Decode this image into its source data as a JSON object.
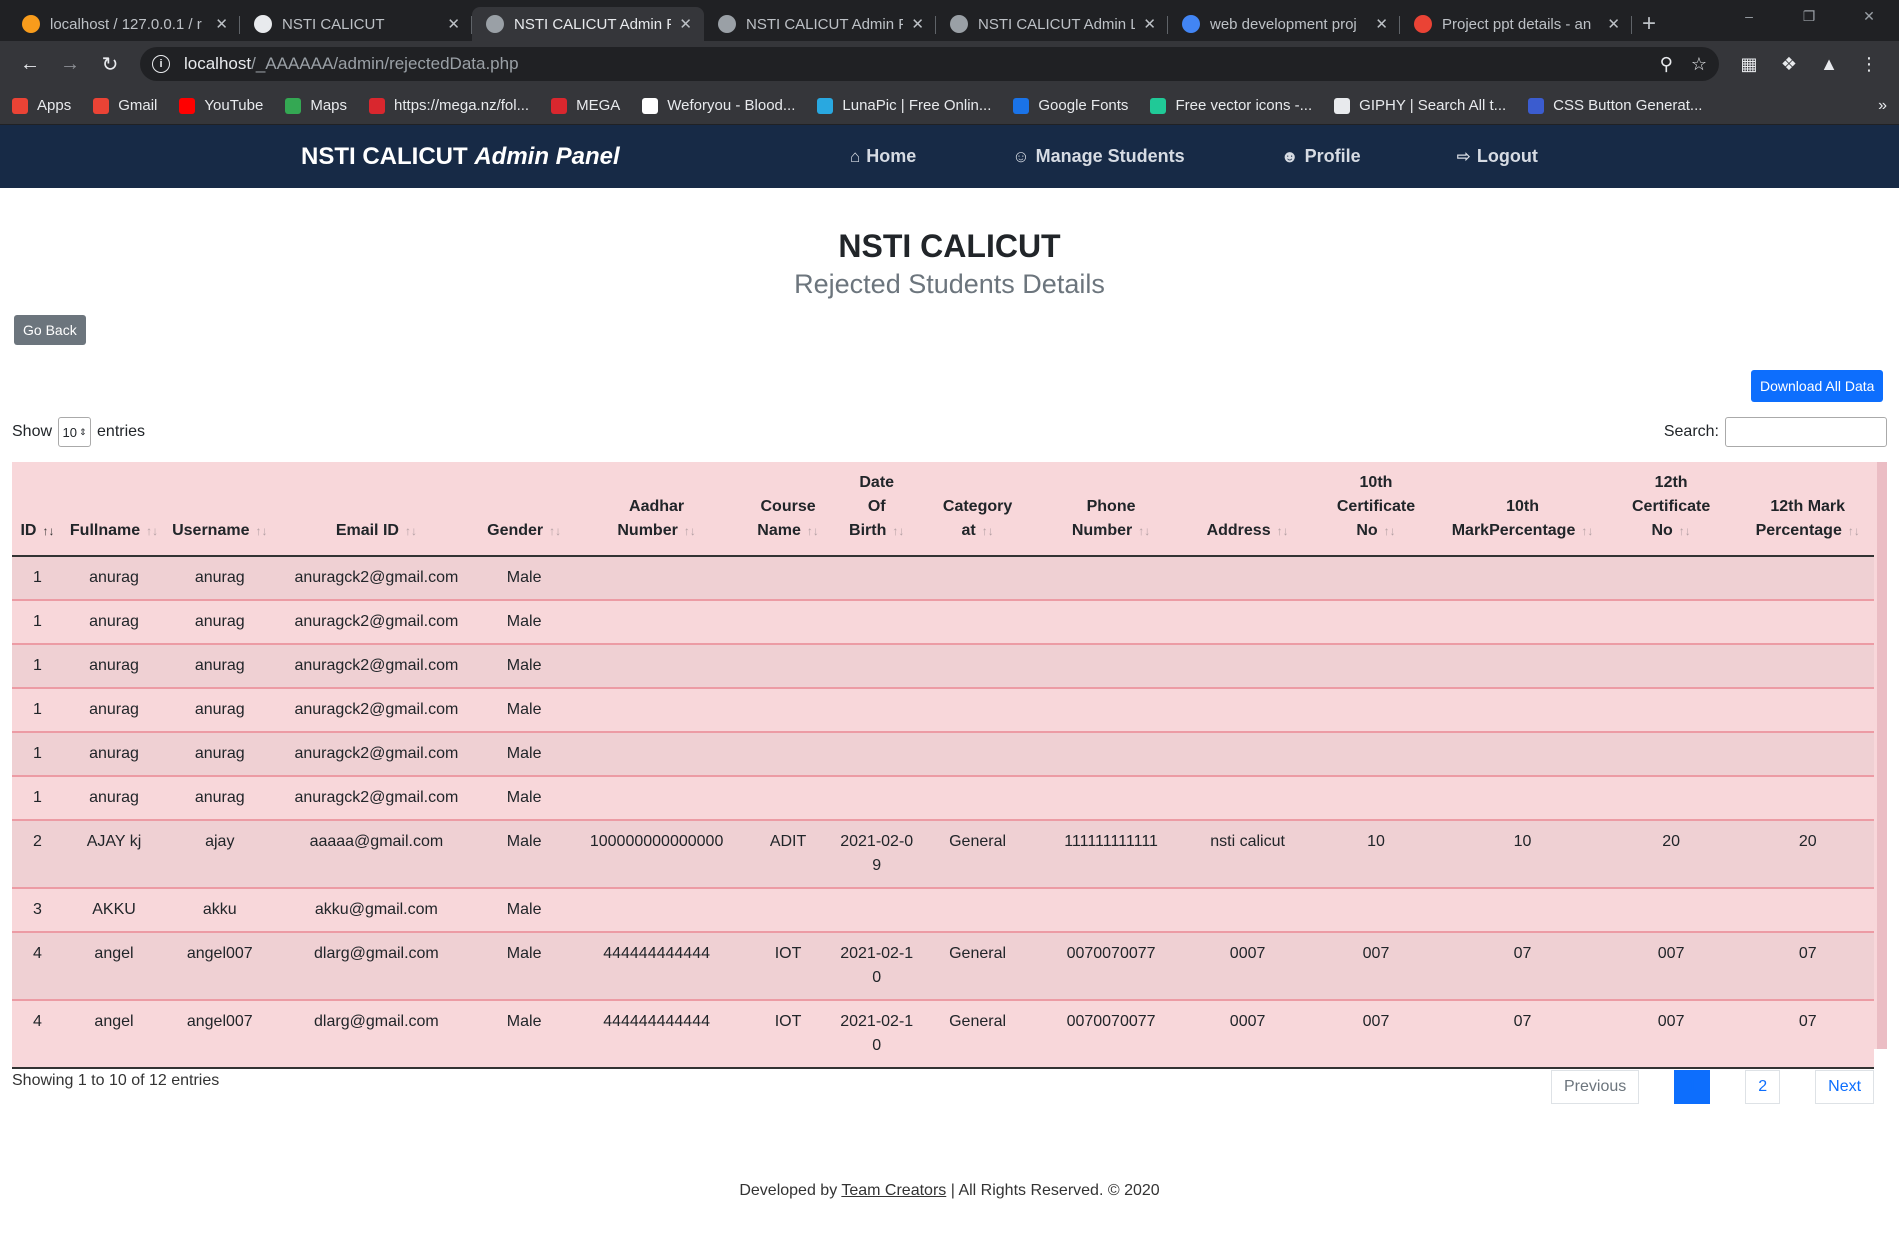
{
  "browser": {
    "tabs": [
      {
        "title": "localhost / 127.0.0.1 / r",
        "icon": "phpmyadmin-icon",
        "color": "#f89c1c",
        "active": false
      },
      {
        "title": "NSTI CALICUT",
        "icon": "site-icon",
        "color": "#e8eaed",
        "active": false
      },
      {
        "title": "NSTI CALICUT Admin P",
        "icon": "globe-icon",
        "color": "#9aa0a6",
        "active": true
      },
      {
        "title": "NSTI CALICUT Admin P",
        "icon": "globe-icon",
        "color": "#9aa0a6",
        "active": false
      },
      {
        "title": "NSTI CALICUT Admin L",
        "icon": "globe-icon",
        "color": "#9aa0a6",
        "active": false
      },
      {
        "title": "web development proj",
        "icon": "google-icon",
        "color": "#4285f4",
        "active": false
      },
      {
        "title": "Project ppt details - an",
        "icon": "gmail-icon",
        "color": "#ea4335",
        "active": false
      }
    ],
    "url_host": "localhost",
    "url_path": "/_AAAAAA/admin/rejectedData.php",
    "bookmarks": [
      {
        "label": "Apps",
        "icon": "apps-grid-icon",
        "color": "#ea4335"
      },
      {
        "label": "Gmail",
        "icon": "gmail-icon",
        "color": "#ea4335"
      },
      {
        "label": "YouTube",
        "icon": "youtube-icon",
        "color": "#ff0000"
      },
      {
        "label": "Maps",
        "icon": "maps-pin-icon",
        "color": "#34a853"
      },
      {
        "label": "https://mega.nz/fol...",
        "icon": "mega-icon",
        "color": "#d9272e"
      },
      {
        "label": "MEGA",
        "icon": "mega-icon",
        "color": "#d9272e"
      },
      {
        "label": "Weforyou - Blood...",
        "icon": "weforyou-icon",
        "color": "#ffffff"
      },
      {
        "label": "LunaPic | Free Onlin...",
        "icon": "lunapic-icon",
        "color": "#29a8e0"
      },
      {
        "label": "Google Fonts",
        "icon": "google-fonts-icon",
        "color": "#1a73e8"
      },
      {
        "label": "Free vector icons -...",
        "icon": "flaticon-icon",
        "color": "#20c997"
      },
      {
        "label": "GIPHY | Search All t...",
        "icon": "globe-icon",
        "color": "#e8eaed"
      },
      {
        "label": "CSS Button Generat...",
        "icon": "css-x-icon",
        "color": "#3b5ccf"
      }
    ]
  },
  "navbar": {
    "brand_main": "NSTI CALICUT",
    "brand_italic": "Admin Panel",
    "links": [
      {
        "label": "Home",
        "icon": "home-icon"
      },
      {
        "label": "Manage Students",
        "icon": "users-icon"
      },
      {
        "label": "Profile",
        "icon": "user-icon"
      },
      {
        "label": "Logout",
        "icon": "logout-icon"
      }
    ]
  },
  "page": {
    "title": "NSTI CALICUT",
    "subtitle": "Rejected Students Details",
    "go_back": "Go Back",
    "download": "Download All Data",
    "show_label": "Show",
    "entries_value": "10",
    "entries_label": "entries",
    "search_label": "Search:",
    "search_value": ""
  },
  "table": {
    "headers": [
      [
        "ID"
      ],
      [
        "Fullname"
      ],
      [
        "Username"
      ],
      [
        "Email ID"
      ],
      [
        "Gender"
      ],
      [
        "Aadhar",
        "Number"
      ],
      [
        "Course",
        "Name"
      ],
      [
        "Date",
        "Of",
        "Birth"
      ],
      [
        "Category",
        "at"
      ],
      [
        "Phone",
        "Number"
      ],
      [
        "Address"
      ],
      [
        "10th",
        "Certificate",
        "No"
      ],
      [
        "10th",
        "MarkPercentage"
      ],
      [
        "12th",
        "Certificate",
        "No"
      ],
      [
        "12th Mark",
        "Percentage"
      ]
    ],
    "rows": [
      [
        "1",
        "anurag",
        "anurag",
        "anuragck2@gmail.com",
        "Male",
        "",
        "",
        "",
        "",
        "",
        "",
        "",
        "",
        "",
        ""
      ],
      [
        "1",
        "anurag",
        "anurag",
        "anuragck2@gmail.com",
        "Male",
        "",
        "",
        "",
        "",
        "",
        "",
        "",
        "",
        "",
        ""
      ],
      [
        "1",
        "anurag",
        "anurag",
        "anuragck2@gmail.com",
        "Male",
        "",
        "",
        "",
        "",
        "",
        "",
        "",
        "",
        "",
        ""
      ],
      [
        "1",
        "anurag",
        "anurag",
        "anuragck2@gmail.com",
        "Male",
        "",
        "",
        "",
        "",
        "",
        "",
        "",
        "",
        "",
        ""
      ],
      [
        "1",
        "anurag",
        "anurag",
        "anuragck2@gmail.com",
        "Male",
        "",
        "",
        "",
        "",
        "",
        "",
        "",
        "",
        "",
        ""
      ],
      [
        "1",
        "anurag",
        "anurag",
        "anuragck2@gmail.com",
        "Male",
        "",
        "",
        "",
        "",
        "",
        "",
        "",
        "",
        "",
        ""
      ],
      [
        "2",
        "AJAY kj",
        "ajay",
        "aaaaa@gmail.com",
        "Male",
        "100000000000000",
        "ADIT",
        "2021-02-09",
        "General",
        "111111111111",
        "nsti calicut",
        "10",
        "10",
        "20",
        "20"
      ],
      [
        "3",
        "AKKU",
        "akku",
        "akku@gmail.com",
        "Male",
        "",
        "",
        "",
        "",
        "",
        "",
        "",
        "",
        "",
        ""
      ],
      [
        "4",
        "angel",
        "angel007",
        "dlarg@gmail.com",
        "Male",
        "444444444444",
        "IOT",
        "2021-02-10",
        "General",
        "0070070077",
        "0007",
        "007",
        "07",
        "007",
        "07"
      ],
      [
        "4",
        "angel",
        "angel007",
        "dlarg@gmail.com",
        "Male",
        "444444444444",
        "IOT",
        "2021-02-10",
        "General",
        "0070070077",
        "0007",
        "007",
        "07",
        "007",
        "07"
      ]
    ]
  },
  "pagination": {
    "info": "Showing 1 to 10 of 12 entries",
    "previous": "Previous",
    "pages": [
      "1",
      "2"
    ],
    "current": "1",
    "next": "Next"
  },
  "footer": {
    "prefix": "Developed by",
    "link": "Team Creators",
    "suffix": "| All Rights Reserved. © 2020"
  }
}
